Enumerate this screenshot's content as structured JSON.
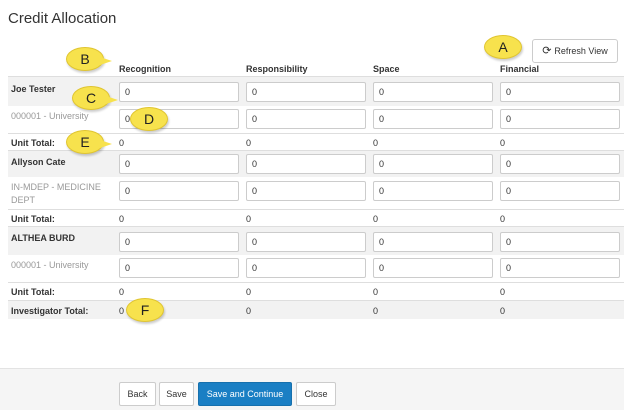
{
  "page": {
    "title": "Credit Allocation"
  },
  "toolbar": {
    "refresh_label": "Refresh View",
    "refresh_icon": "refresh-icon"
  },
  "columns": [
    "Recognition",
    "Responsibility",
    "Space",
    "Financial"
  ],
  "people": [
    {
      "name": "Joe Tester",
      "name_values": [
        "0",
        "0",
        "0",
        "0"
      ],
      "unit": "000001 - University",
      "unit_values": [
        "0",
        "0",
        "0",
        "0"
      ],
      "total_label": "Unit Total:",
      "totals": [
        "0",
        "0",
        "0",
        "0"
      ]
    },
    {
      "name": "Allyson Cate",
      "name_values": [
        "0",
        "0",
        "0",
        "0"
      ],
      "unit": "IN-MDEP - MEDICINE DEPT",
      "unit_values": [
        "0",
        "0",
        "0",
        "0"
      ],
      "total_label": "Unit Total:",
      "totals": [
        "0",
        "0",
        "0",
        "0"
      ]
    },
    {
      "name": "ALTHEA BURD",
      "name_values": [
        "0",
        "0",
        "0",
        "0"
      ],
      "unit": "000001 - University",
      "unit_values": [
        "0",
        "0",
        "0",
        "0"
      ],
      "total_label": "Unit Total:",
      "totals": [
        "0",
        "0",
        "0",
        "0"
      ]
    }
  ],
  "investigator_total": {
    "label": "Investigator Total:",
    "values": [
      "0",
      "0",
      "0",
      "0"
    ]
  },
  "callouts": [
    "A",
    "B",
    "C",
    "D",
    "E",
    "F"
  ],
  "footer": {
    "back": "Back",
    "save": "Save",
    "save_continue": "Save and Continue",
    "close": "Close"
  },
  "colors": {
    "primary": "#1a7fc4",
    "callout": "#f7e24d",
    "row_shade": "#f2f2f2"
  }
}
